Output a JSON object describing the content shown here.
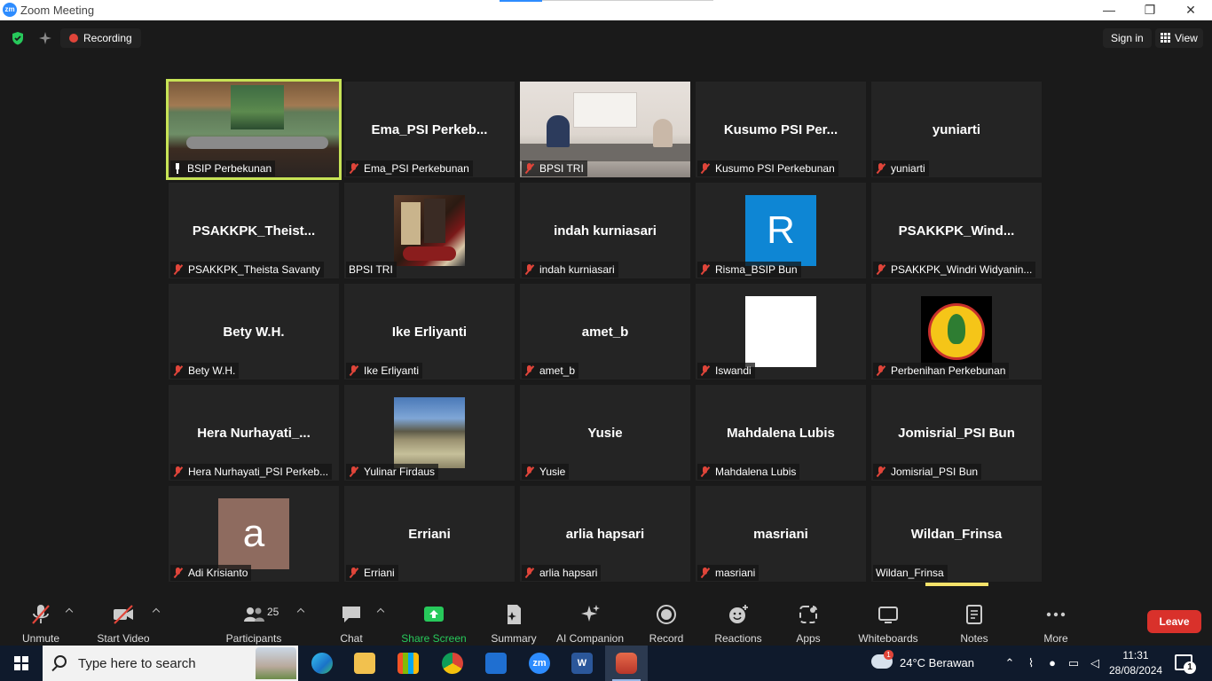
{
  "window": {
    "app_logo": "zm",
    "title": "Zoom Meeting",
    "minimize": "—",
    "maximize": "❐",
    "close": "✕"
  },
  "topbar": {
    "security_icon": "shield-check-icon",
    "sparkle_icon": "sparkle-icon",
    "recording_label": "Recording",
    "signin_label": "Sign in",
    "view_label": "View"
  },
  "gallery": {
    "tiles": [
      {
        "label": "BSIP Perbekunan",
        "center": "",
        "type": "video-meeting",
        "muted": false,
        "pinned": true,
        "active": true
      },
      {
        "label": "Ema_PSI Perkebunan",
        "center": "Ema_PSI  Perkeb...",
        "type": "name",
        "muted": true
      },
      {
        "label": "BPSI TRI",
        "center": "",
        "type": "video-office",
        "muted": true
      },
      {
        "label": "Kusumo PSI Perkebunan",
        "center": "Kusumo  PSI  Per...",
        "type": "name",
        "muted": true
      },
      {
        "label": "yuniarti",
        "center": "yuniarti",
        "type": "name",
        "muted": true
      },
      {
        "label": "PSAKKPK_Theista Savanty",
        "center": "PSAKKPK_Theist...",
        "type": "name",
        "muted": true
      },
      {
        "label": "BPSI TRI",
        "center": "",
        "type": "avatar-coffee",
        "muted": false
      },
      {
        "label": "indah kurniasari",
        "center": "indah kurniasari",
        "type": "name",
        "muted": true
      },
      {
        "label": "Risma_BSIP Bun",
        "center": "R",
        "type": "avatar-letter-blue",
        "muted": true
      },
      {
        "label": "PSAKKPK_Windri Widyanin...",
        "center": "PSAKKPK_Wind...",
        "type": "name",
        "muted": true
      },
      {
        "label": "Bety W.H.",
        "center": "Bety W.H.",
        "type": "name",
        "muted": true
      },
      {
        "label": "Ike Erliyanti",
        "center": "Ike Erliyanti",
        "type": "name",
        "muted": true
      },
      {
        "label": "amet_b",
        "center": "amet_b",
        "type": "name",
        "muted": true
      },
      {
        "label": "Iswandi",
        "center": "",
        "type": "avatar-white",
        "muted": true
      },
      {
        "label": "Perbenihan Perkebunan",
        "center": "",
        "type": "avatar-logo",
        "muted": true
      },
      {
        "label": "Hera Nurhayati_PSI Perkeb...",
        "center": "Hera  Nurhayati_...",
        "type": "name",
        "muted": true
      },
      {
        "label": "Yulinar Firdaus",
        "center": "",
        "type": "avatar-landscape",
        "muted": true
      },
      {
        "label": "Yusie",
        "center": "Yusie",
        "type": "name",
        "muted": true
      },
      {
        "label": "Mahdalena Lubis",
        "center": "Mahdalena Lubis",
        "type": "name",
        "muted": true
      },
      {
        "label": "Jomisrial_PSI Bun",
        "center": "Jomisrial_PSI Bun",
        "type": "name",
        "muted": true
      },
      {
        "label": "Adi Krisianto",
        "center": "a",
        "type": "avatar-letter-brown",
        "muted": true
      },
      {
        "label": "Erriani",
        "center": "Erriani",
        "type": "name",
        "muted": true
      },
      {
        "label": "arlia hapsari",
        "center": "arlia hapsari",
        "type": "name",
        "muted": true
      },
      {
        "label": "masriani",
        "center": "masriani",
        "type": "name",
        "muted": true
      },
      {
        "label": "Wildan_Frinsa",
        "center": "Wildan_Frinsa",
        "type": "name",
        "muted": false
      }
    ]
  },
  "toolbar": {
    "unmute": "Unmute",
    "start_video": "Start Video",
    "participants": "Participants",
    "participants_count": "25",
    "chat": "Chat",
    "share_screen": "Share Screen",
    "summary": "Summary",
    "ai_companion": "AI Companion",
    "record": "Record",
    "reactions": "Reactions",
    "apps": "Apps",
    "whiteboards": "Whiteboards",
    "notes": "Notes",
    "more": "More",
    "leave": "Leave",
    "accent_green": "#27c95b",
    "leave_color": "#d9312b"
  },
  "taskbar": {
    "search_placeholder": "Type here to search",
    "apps": [
      "edge",
      "file-explorer",
      "microsoft-store",
      "chrome",
      "mail",
      "zoom",
      "word",
      "recorder"
    ],
    "zoom_glyph": "zm",
    "word_glyph": "W",
    "weather_badge": "1",
    "weather": "24°C  Berawan",
    "time": "11:31",
    "date": "28/08/2024",
    "notifications": "1"
  }
}
